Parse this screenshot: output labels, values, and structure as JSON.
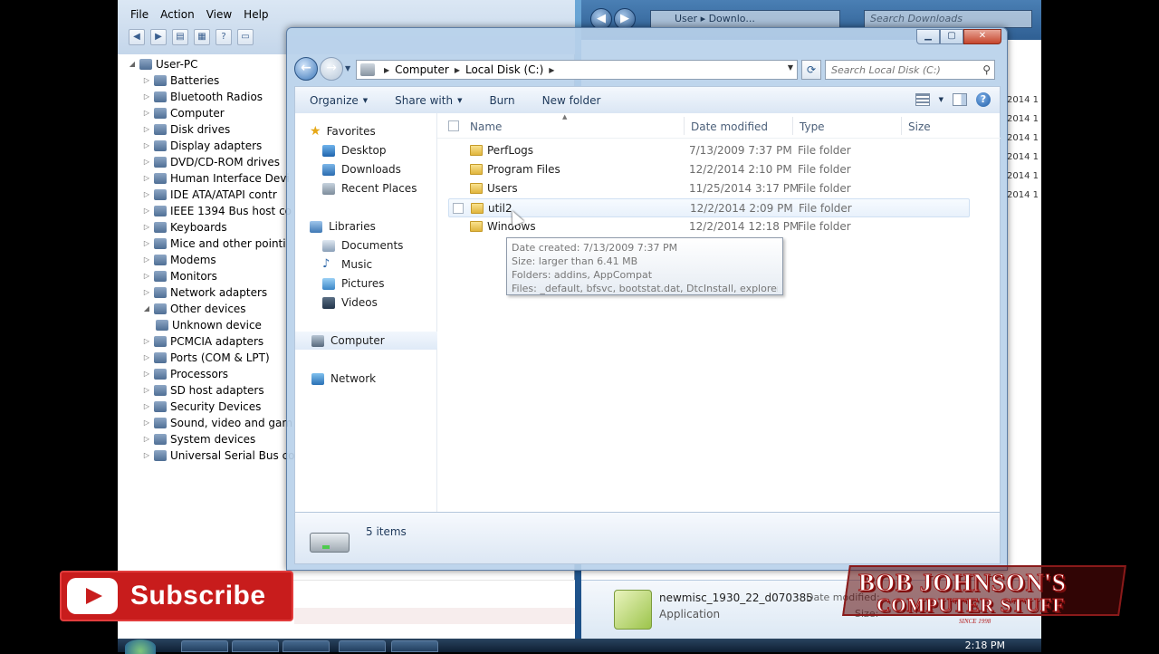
{
  "device_manager": {
    "menu": [
      "File",
      "Action",
      "View",
      "Help"
    ],
    "tree_root": "User-PC",
    "tree": [
      {
        "label": "Batteries",
        "expanded": false
      },
      {
        "label": "Bluetooth Radios",
        "expanded": false
      },
      {
        "label": "Computer",
        "expanded": false
      },
      {
        "label": "Disk drives",
        "expanded": false
      },
      {
        "label": "Display adapters",
        "expanded": false
      },
      {
        "label": "DVD/CD-ROM drives",
        "expanded": false
      },
      {
        "label": "Human Interface Devi",
        "expanded": false
      },
      {
        "label": "IDE ATA/ATAPI contr",
        "expanded": false
      },
      {
        "label": "IEEE 1394 Bus host co",
        "expanded": false
      },
      {
        "label": "Keyboards",
        "expanded": false
      },
      {
        "label": "Mice and other pointi",
        "expanded": false
      },
      {
        "label": "Modems",
        "expanded": false
      },
      {
        "label": "Monitors",
        "expanded": false
      },
      {
        "label": "Network adapters",
        "expanded": false
      },
      {
        "label": "Other devices",
        "expanded": true
      },
      {
        "label": "Unknown device",
        "child": true
      },
      {
        "label": "PCMCIA adapters",
        "expanded": false
      },
      {
        "label": "Ports (COM & LPT)",
        "expanded": false
      },
      {
        "label": "Processors",
        "expanded": false
      },
      {
        "label": "SD host adapters",
        "expanded": false
      },
      {
        "label": "Security Devices",
        "expanded": false
      },
      {
        "label": "Sound, video and gam",
        "expanded": false
      },
      {
        "label": "System devices",
        "expanded": false
      },
      {
        "label": "Universal Serial Bus co",
        "expanded": false
      }
    ]
  },
  "downloads_window": {
    "address": "User ▸ Downlo...",
    "search_placeholder": "Search Downloads",
    "date_fragments": [
      "2014 1",
      "2014 1",
      "2014 1",
      "2014 1",
      "2014 1",
      "2014 1"
    ],
    "file_name": "newmisc_1930_22_d070385",
    "file_type": "Application",
    "meta_date_label": "Date modified:",
    "meta_size_label": "Size:"
  },
  "explorer": {
    "address": {
      "segments": [
        "Computer",
        "Local Disk (C:)"
      ]
    },
    "search_placeholder": "Search Local Disk (C:)",
    "commands": {
      "organize": "Organize",
      "share": "Share with",
      "burn": "Burn",
      "new_folder": "New folder"
    },
    "nav": {
      "favorites": "Favorites",
      "fav_items": [
        "Desktop",
        "Downloads",
        "Recent Places"
      ],
      "libraries": "Libraries",
      "lib_items": [
        "Documents",
        "Music",
        "Pictures",
        "Videos"
      ],
      "computer": "Computer",
      "network": "Network"
    },
    "columns": {
      "name": "Name",
      "date": "Date modified",
      "type": "Type",
      "size": "Size"
    },
    "files": [
      {
        "name": "PerfLogs",
        "date": "7/13/2009 7:37 PM",
        "type": "File folder"
      },
      {
        "name": "Program Files",
        "date": "12/2/2014 2:10 PM",
        "type": "File folder"
      },
      {
        "name": "Users",
        "date": "11/25/2014 3:17 PM",
        "type": "File folder"
      },
      {
        "name": "util2",
        "date": "12/2/2014 2:09 PM",
        "type": "File folder"
      },
      {
        "name": "Windows",
        "date": "12/2/2014 12:18 PM",
        "type": "File folder"
      }
    ],
    "tooltip": [
      "Date created: 7/13/2009 7:37 PM",
      "Size: larger than 6.41 MB",
      "Folders: addins, AppCompat",
      "Files: _default, bfsvc, bootstat.dat, DtcInstall, explorer, ..."
    ],
    "status": "5 items"
  },
  "taskbar": {
    "clock": "2:18 PM"
  },
  "overlay": {
    "subscribe": "Subscribe",
    "brand_line1": "BOB JOHNSON'S",
    "brand_line2": "COMPUTER STUFF",
    "brand_since": "SINCE 1998"
  },
  "colors": {
    "subscribe_red": "#c81c1c",
    "brand_red": "#a01515",
    "accent": "#1e395b"
  }
}
